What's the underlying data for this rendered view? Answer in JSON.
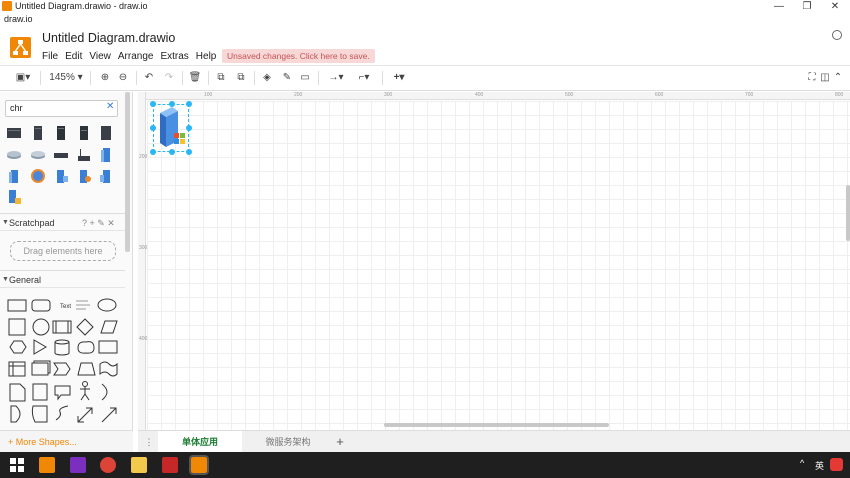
{
  "window": {
    "title": "Untitled Diagram.drawio - draw.io",
    "url_label": "draw.io",
    "minimize": "—",
    "maximize": "❐",
    "close": "✕"
  },
  "header": {
    "doc_title": "Untitled Diagram.drawio",
    "menu": [
      "File",
      "Edit",
      "View",
      "Arrange",
      "Extras",
      "Help"
    ],
    "unsaved_notice": "Unsaved changes. Click here to save."
  },
  "toolbar": {
    "zoom": "145%"
  },
  "sidebar": {
    "search_value": "chr",
    "scratchpad_title": "Scratchpad",
    "scratchpad_actions": "? + ✎ ✕",
    "drag_hint": "Drag elements here",
    "general_title": "General",
    "text_shape": "Text",
    "more_shapes": "+ More Shapes..."
  },
  "rulers": {
    "top": [
      "100",
      "200",
      "300",
      "400",
      "500",
      "600",
      "700",
      "800"
    ],
    "left": [
      "200",
      "300",
      "400"
    ]
  },
  "pages": {
    "active": "单体应用",
    "other": "微服务架构",
    "add": "+"
  },
  "taskbar": {
    "lang": "英",
    "tray_up": "^"
  },
  "colors": {
    "brand": "#f08705",
    "selection": "#29b6f2",
    "active_tab": "#1e7e34"
  }
}
